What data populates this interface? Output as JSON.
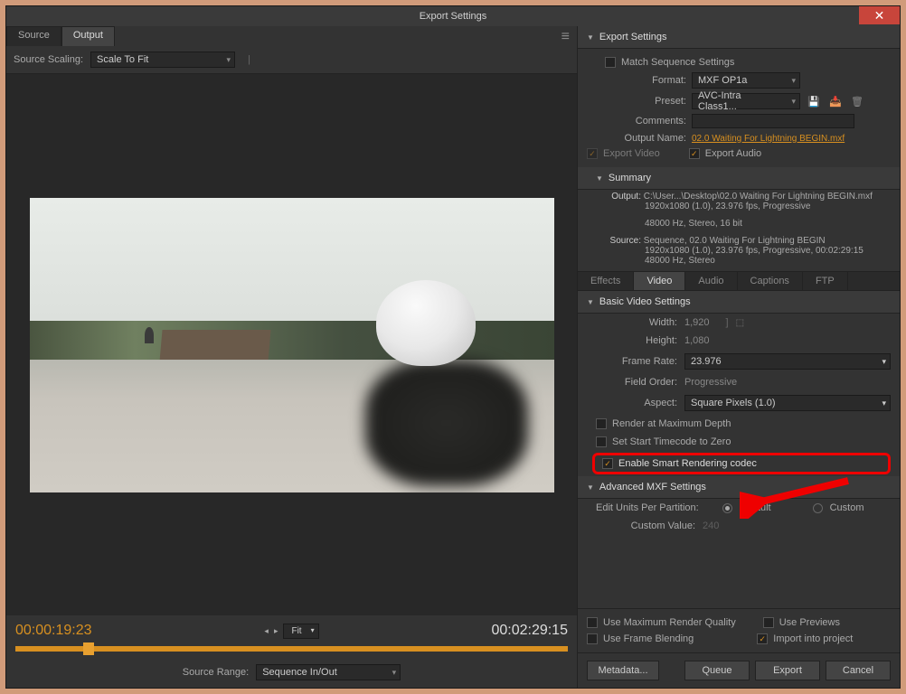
{
  "title": "Export Settings",
  "left": {
    "tabs": [
      "Source",
      "Output"
    ],
    "scaling_label": "Source Scaling:",
    "scaling_value": "Scale To Fit",
    "time_current": "00:00:19:23",
    "time_total": "00:02:29:15",
    "fit": "Fit",
    "range_label": "Source Range:",
    "range_value": "Sequence In/Out"
  },
  "export": {
    "header": "Export Settings",
    "match": "Match Sequence Settings",
    "format_label": "Format:",
    "format_value": "MXF OP1a",
    "preset_label": "Preset:",
    "preset_value": "AVC-Intra Class1...",
    "comments_label": "Comments:",
    "output_name_label": "Output Name:",
    "output_name_value": "02.0 Waiting For Lightning BEGIN.mxf",
    "export_video": "Export Video",
    "export_audio": "Export Audio",
    "summary": "Summary",
    "output_label": "Output:",
    "output_line1": "C:\\User...\\Desktop\\02.0 Waiting For Lightning BEGIN.mxf",
    "output_line2": "1920x1080 (1.0), 23.976 fps, Progressive",
    "output_line3": "48000 Hz, Stereo, 16 bit",
    "source_label": "Source:",
    "source_line1": "Sequence, 02.0 Waiting For Lightning BEGIN",
    "source_line2": "1920x1080 (1.0), 23.976 fps, Progressive, 00:02:29:15",
    "source_line3": "48000 Hz, Stereo"
  },
  "mid_tabs": [
    "Effects",
    "Video",
    "Audio",
    "Captions",
    "FTP"
  ],
  "video": {
    "basic_header": "Basic Video Settings",
    "width_label": "Width:",
    "width_value": "1,920",
    "height_label": "Height:",
    "height_value": "1,080",
    "framerate_label": "Frame Rate:",
    "framerate_value": "23.976",
    "fieldorder_label": "Field Order:",
    "fieldorder_value": "Progressive",
    "aspect_label": "Aspect:",
    "aspect_value": "Square Pixels (1.0)",
    "render_max": "Render at Maximum Depth",
    "start_tc": "Set Start Timecode to Zero",
    "smart_render": "Enable Smart Rendering codec",
    "adv_header": "Advanced MXF Settings",
    "partition_label": "Edit Units Per Partition:",
    "default": "Default",
    "custom": "Custom",
    "custom_value_label": "Custom Value:",
    "custom_value": "240"
  },
  "bottom": {
    "max_quality": "Use Maximum Render Quality",
    "previews": "Use Previews",
    "frame_blend": "Use Frame Blending",
    "import": "Import into project",
    "metadata": "Metadata...",
    "queue": "Queue",
    "export": "Export",
    "cancel": "Cancel"
  }
}
